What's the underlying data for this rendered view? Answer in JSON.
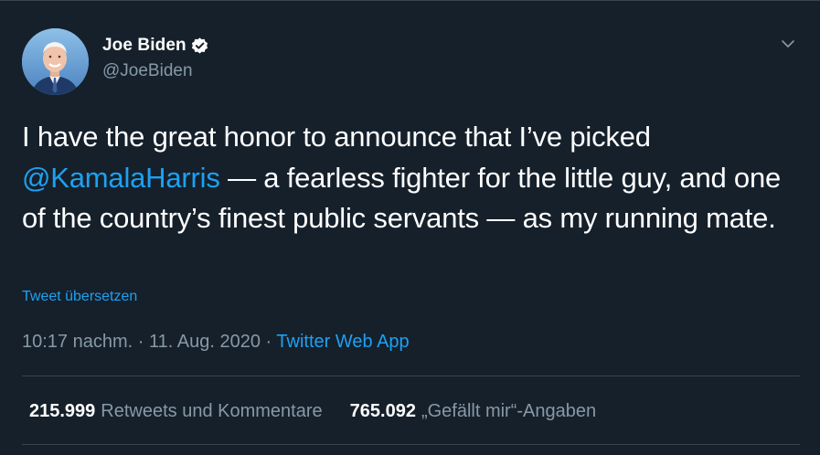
{
  "author": {
    "display_name": "Joe Biden",
    "handle": "@JoeBiden",
    "verified": true,
    "avatar_icon": "profile-photo"
  },
  "tweet": {
    "text_before_mention": "I have the great honor to announce that I’ve picked",
    "mention": "@KamalaHarris",
    "text_after_mention": "— a fearless fighter for the little guy, and one of the country’s finest public servants — as my running mate."
  },
  "translate_label": "Tweet übersetzen",
  "meta": {
    "time": "10:17 nachm.",
    "separator": "·",
    "date": "11. Aug. 2020",
    "source": "Twitter Web App"
  },
  "stats": {
    "retweets_count": "215.999",
    "retweets_label": "Retweets und Kommentare",
    "likes_count": "765.092",
    "likes_label": "„Gefällt mir“-Angaben"
  },
  "colors": {
    "background": "#15202b",
    "accent": "#1da1f2",
    "secondary_text": "#8899a6",
    "divider": "#38444d"
  }
}
